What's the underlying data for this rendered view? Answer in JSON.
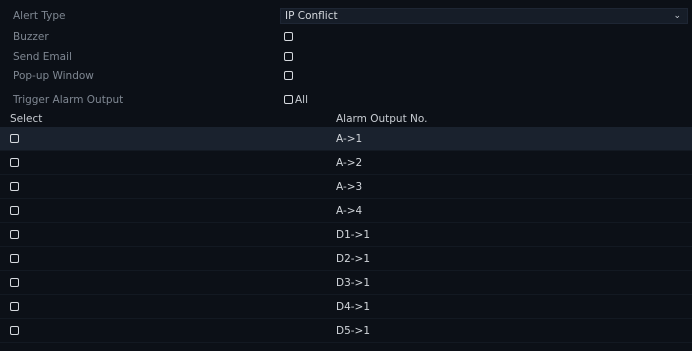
{
  "form": {
    "alert_type_label": "Alert Type",
    "alert_type_value": "IP Conflict",
    "buzzer_label": "Buzzer",
    "send_email_label": "Send Email",
    "popup_window_label": "Pop-up Window",
    "trigger_alarm_output_label": "Trigger Alarm Output",
    "all_label": "All"
  },
  "table": {
    "col_select": "Select",
    "col_output": "Alarm Output No.",
    "rows": [
      {
        "output": "A->1"
      },
      {
        "output": "A->2"
      },
      {
        "output": "A->3"
      },
      {
        "output": "A->4"
      },
      {
        "output": "D1->1"
      },
      {
        "output": "D2->1"
      },
      {
        "output": "D3->1"
      },
      {
        "output": "D4->1"
      },
      {
        "output": "D5->1"
      }
    ]
  },
  "colors": {
    "background": "#0c1017",
    "selected_row": "#1a222e",
    "text": "#d2d6db",
    "label": "#7f8792"
  }
}
